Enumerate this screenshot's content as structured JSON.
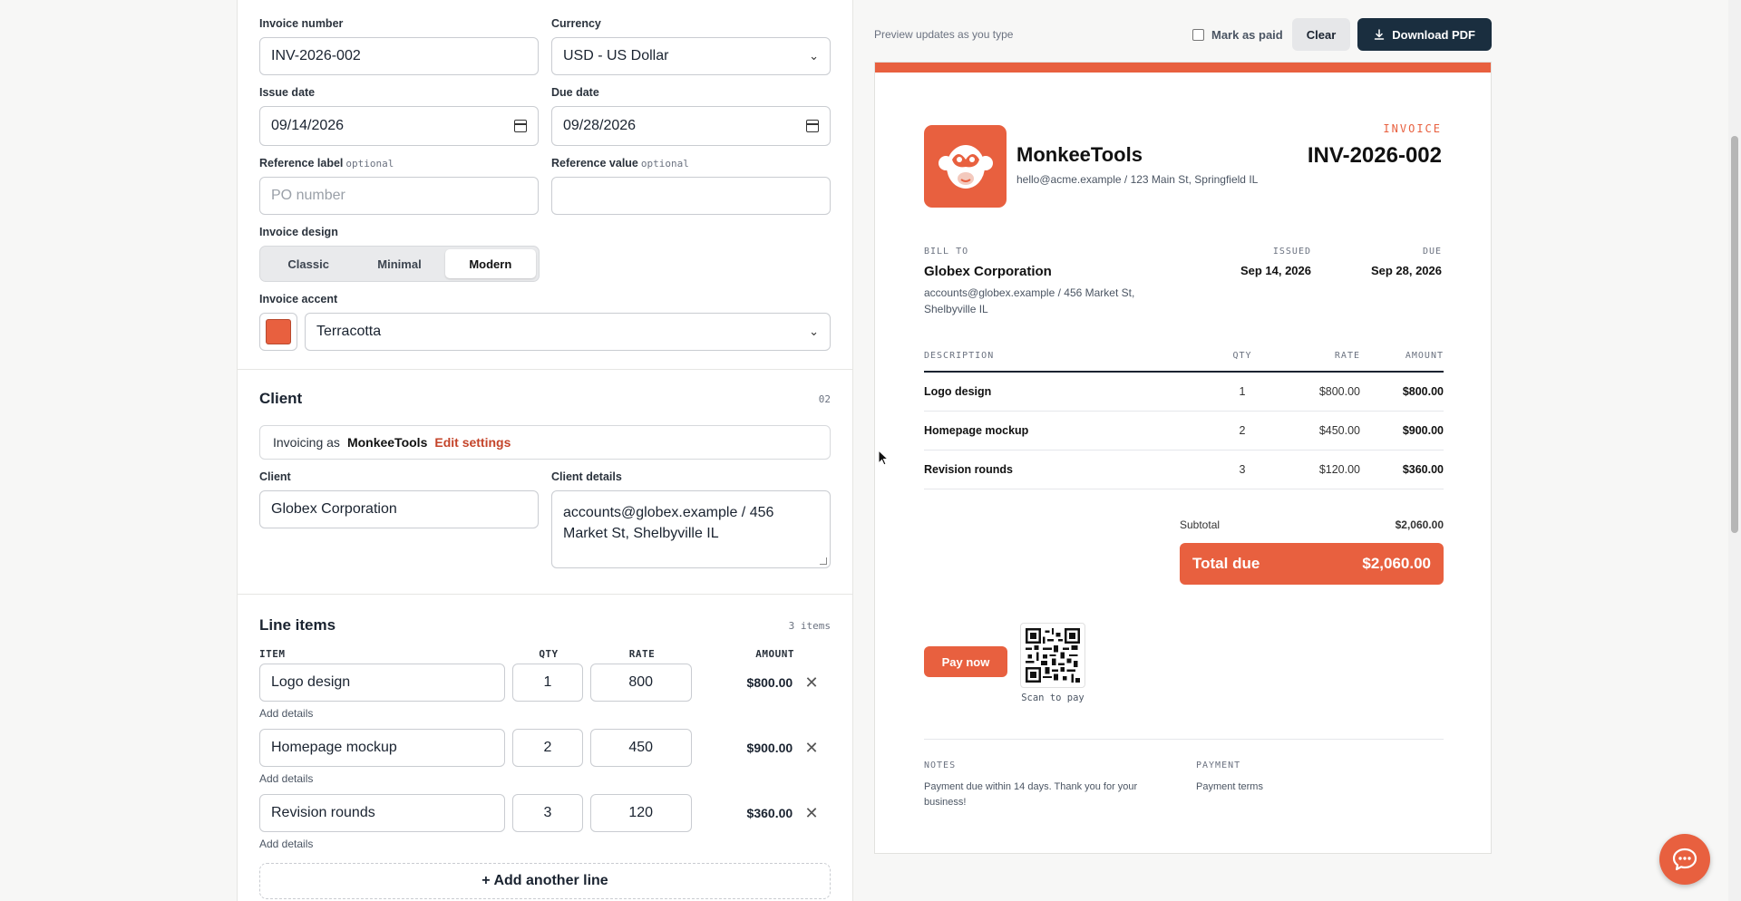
{
  "form": {
    "invoice_number": {
      "label": "Invoice number",
      "value": "INV-2026-002"
    },
    "currency": {
      "label": "Currency",
      "value": "USD - US Dollar"
    },
    "issue_date": {
      "label": "Issue date",
      "value": "09/14/2026"
    },
    "due_date": {
      "label": "Due date",
      "value": "09/28/2026"
    },
    "reference_label": {
      "label": "Reference label",
      "optional": "optional",
      "placeholder": "PO number",
      "value": ""
    },
    "reference_value": {
      "label": "Reference value",
      "optional": "optional",
      "value": ""
    },
    "design": {
      "label": "Invoice design",
      "options": [
        "Classic",
        "Minimal",
        "Modern"
      ],
      "selected": "Modern"
    },
    "accent": {
      "label": "Invoice accent",
      "value": "Terracotta",
      "color": "#E8603F"
    }
  },
  "client_section": {
    "title": "Client",
    "number": "02",
    "invoicing_as_label": "Invoicing as",
    "business_name": "MonkeeTools",
    "edit_settings": "Edit settings",
    "client_label": "Client",
    "client_value": "Globex Corporation",
    "details_label": "Client details",
    "details_value": "accounts@globex.example / 456 Market St, Shelbyville IL"
  },
  "line_items": {
    "title": "Line items",
    "count": "3 items",
    "headers": {
      "item": "ITEM",
      "qty": "QTY",
      "rate": "RATE",
      "amount": "AMOUNT"
    },
    "rows": [
      {
        "item": "Logo design",
        "qty": "1",
        "rate": "800",
        "amount": "$800.00"
      },
      {
        "item": "Homepage mockup",
        "qty": "2",
        "rate": "450",
        "amount": "$900.00"
      },
      {
        "item": "Revision rounds",
        "qty": "3",
        "rate": "120",
        "amount": "$360.00"
      }
    ],
    "add_details": "Add details",
    "add_line": "+ Add another line"
  },
  "preview_toolbar": {
    "hint": "Preview updates as you type",
    "mark_paid": "Mark as paid",
    "clear": "Clear",
    "download": "Download PDF"
  },
  "invoice": {
    "accent": "#E8603F",
    "company": "MonkeeTools",
    "company_sub": "hello@acme.example / 123 Main St, Springfield IL",
    "label": "INVOICE",
    "number": "INV-2026-002",
    "bill_to_label": "BILL TO",
    "bill_to_name": "Globex Corporation",
    "bill_to_addr": "accounts@globex.example / 456 Market St, Shelbyville IL",
    "issued_label": "ISSUED",
    "issued": "Sep 14, 2026",
    "due_label": "DUE",
    "due": "Sep 28, 2026",
    "table_headers": {
      "desc": "DESCRIPTION",
      "qty": "QTY",
      "rate": "RATE",
      "amount": "AMOUNT"
    },
    "rows": [
      {
        "desc": "Logo design",
        "qty": "1",
        "rate": "$800.00",
        "amount": "$800.00"
      },
      {
        "desc": "Homepage mockup",
        "qty": "2",
        "rate": "$450.00",
        "amount": "$900.00"
      },
      {
        "desc": "Revision rounds",
        "qty": "3",
        "rate": "$120.00",
        "amount": "$360.00"
      }
    ],
    "subtotal_label": "Subtotal",
    "subtotal": "$2,060.00",
    "total_label": "Total due",
    "total": "$2,060.00",
    "pay_now": "Pay now",
    "scan_to_pay": "Scan to pay",
    "notes_label": "NOTES",
    "notes": "Payment due within 14 days. Thank you for your business!",
    "payment_label": "PAYMENT",
    "payment": "Payment terms"
  },
  "icons": {
    "chat": "chat-bubble-icon",
    "download": "download-icon",
    "remove": "close-icon",
    "logo": "monkey-logo-icon"
  }
}
